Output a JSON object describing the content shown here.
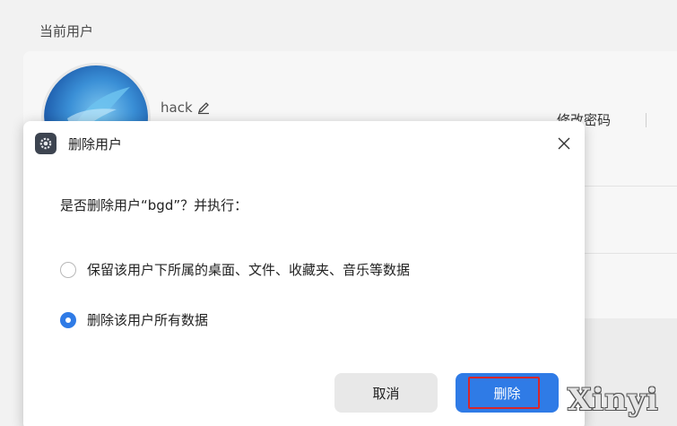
{
  "page": {
    "section_title": "当前用户",
    "username": "hack",
    "change_password": "修改密码"
  },
  "dialog": {
    "title": "删除用户",
    "question": "是否删除用户“bgd”？并执行：",
    "options": [
      {
        "label": "保留该用户下所属的桌面、文件、收藏夹、音乐等数据",
        "checked": false
      },
      {
        "label": "删除该用户所有数据",
        "checked": true
      }
    ],
    "cancel_label": "取消",
    "delete_label": "删除"
  },
  "watermark": "Xinyi",
  "colors": {
    "accent": "#2f7be6",
    "highlight": "#d6262b"
  }
}
